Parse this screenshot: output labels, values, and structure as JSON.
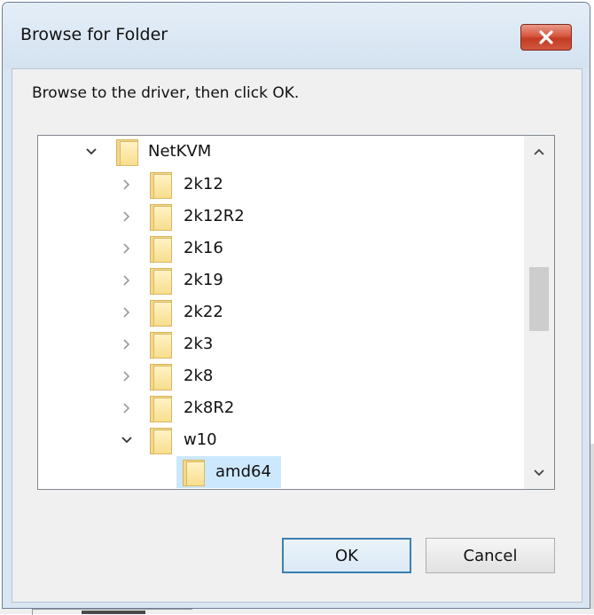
{
  "window": {
    "title": "Browse for Folder",
    "close_icon": "close-icon"
  },
  "instruction": "Browse to the driver, then click OK.",
  "tree": {
    "rows": [
      {
        "label": "NetKVM",
        "expander": "chevron-down",
        "level": 0
      },
      {
        "label": "2k12",
        "expander": "chevron-right",
        "level": 1
      },
      {
        "label": "2k12R2",
        "expander": "chevron-right",
        "level": 1
      },
      {
        "label": "2k16",
        "expander": "chevron-right",
        "level": 1
      },
      {
        "label": "2k19",
        "expander": "chevron-right",
        "level": 1
      },
      {
        "label": "2k22",
        "expander": "chevron-right",
        "level": 1
      },
      {
        "label": "2k3",
        "expander": "chevron-right",
        "level": 1
      },
      {
        "label": "2k8",
        "expander": "chevron-right",
        "level": 1
      },
      {
        "label": "2k8R2",
        "expander": "chevron-right",
        "level": 1
      },
      {
        "label": "w10",
        "expander": "chevron-down",
        "level": 1
      },
      {
        "label": "amd64",
        "expander": "",
        "level": 2,
        "selected": true
      }
    ],
    "scroll_position": 0.4
  },
  "buttons": {
    "ok": "OK",
    "cancel": "Cancel"
  },
  "colors": {
    "selection": "#cce8ff",
    "close_red": "#c33b24",
    "default_button_border": "#3c7fb1"
  }
}
